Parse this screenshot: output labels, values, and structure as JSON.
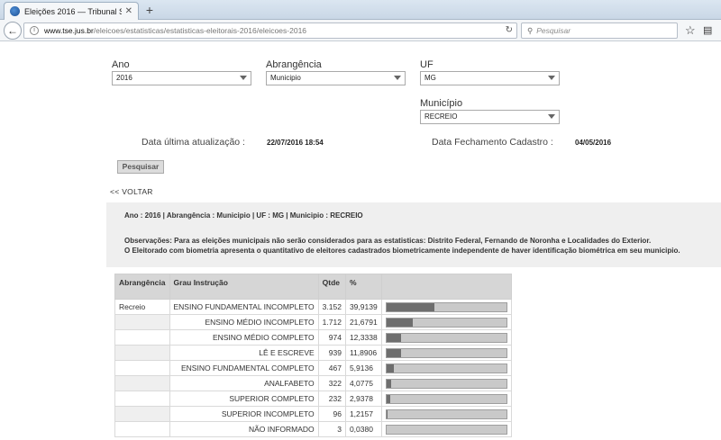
{
  "browser": {
    "tab_title": "Eleições 2016 — Tribunal S...",
    "tab_close": "✕",
    "new_tab": "+",
    "url_host": "www.tse.jus.br",
    "url_path": "/eleicoes/estatisticas/estatisticas-eleitorais-2016/eleicoes-2016",
    "search_placeholder": "Pesquisar"
  },
  "filters": {
    "ano_label": "Ano",
    "ano_value": "2016",
    "abrangencia_label": "Abrangência",
    "abrangencia_value": "Municipio",
    "uf_label": "UF",
    "uf_value": "MG",
    "municipio_label": "Município",
    "municipio_value": "RECREIO"
  },
  "dates": {
    "atualizacao_label": "Data última atualização :",
    "atualizacao_value": "22/07/2016 18:54",
    "fechamento_label": "Data Fechamento Cadastro :",
    "fechamento_value": "04/05/2016"
  },
  "actions": {
    "pesquisar": "Pesquisar",
    "voltar": "<< VOLTAR"
  },
  "summary": {
    "line": "Ano : 2016 | Abrangência : Municipio | UF : MG | Municipio : RECREIO",
    "obs1": "Observações: Para as eleições municipais não serão considerados para as estatisticas: Distrito Federal, Fernando de Noronha e Localidades do Exterior.",
    "obs2": "O Eleitorado com biometria apresenta o quantitativo de eleitores cadastrados biometricamente independente de haver identificação biométrica em seu municipio."
  },
  "table": {
    "headers": [
      "Abrangência",
      "Grau Instrução",
      "Qtde",
      "%"
    ],
    "rows": [
      {
        "abrangencia": "Recreio",
        "grau": "ENSINO FUNDAMENTAL INCOMPLETO",
        "qtde": "3.152",
        "pct": "39,9139",
        "frac": 0.399139
      },
      {
        "abrangencia": "",
        "grau": "ENSINO MÉDIO INCOMPLETO",
        "qtde": "1.712",
        "pct": "21,6791",
        "frac": 0.216791
      },
      {
        "abrangencia": "",
        "grau": "ENSINO MÉDIO COMPLETO",
        "qtde": "974",
        "pct": "12,3338",
        "frac": 0.123338
      },
      {
        "abrangencia": "",
        "grau": "LÊ E ESCREVE",
        "qtde": "939",
        "pct": "11,8906",
        "frac": 0.118906
      },
      {
        "abrangencia": "",
        "grau": "ENSINO FUNDAMENTAL COMPLETO",
        "qtde": "467",
        "pct": "5,9136",
        "frac": 0.059136
      },
      {
        "abrangencia": "",
        "grau": "ANALFABETO",
        "qtde": "322",
        "pct": "4,0775",
        "frac": 0.040775
      },
      {
        "abrangencia": "",
        "grau": "SUPERIOR COMPLETO",
        "qtde": "232",
        "pct": "2,9378",
        "frac": 0.029378
      },
      {
        "abrangencia": "",
        "grau": "SUPERIOR INCOMPLETO",
        "qtde": "96",
        "pct": "1,2157",
        "frac": 0.012157
      },
      {
        "abrangencia": "",
        "grau": "NÃO INFORMADO",
        "qtde": "3",
        "pct": "0,0380",
        "frac": 0.00038
      }
    ]
  }
}
